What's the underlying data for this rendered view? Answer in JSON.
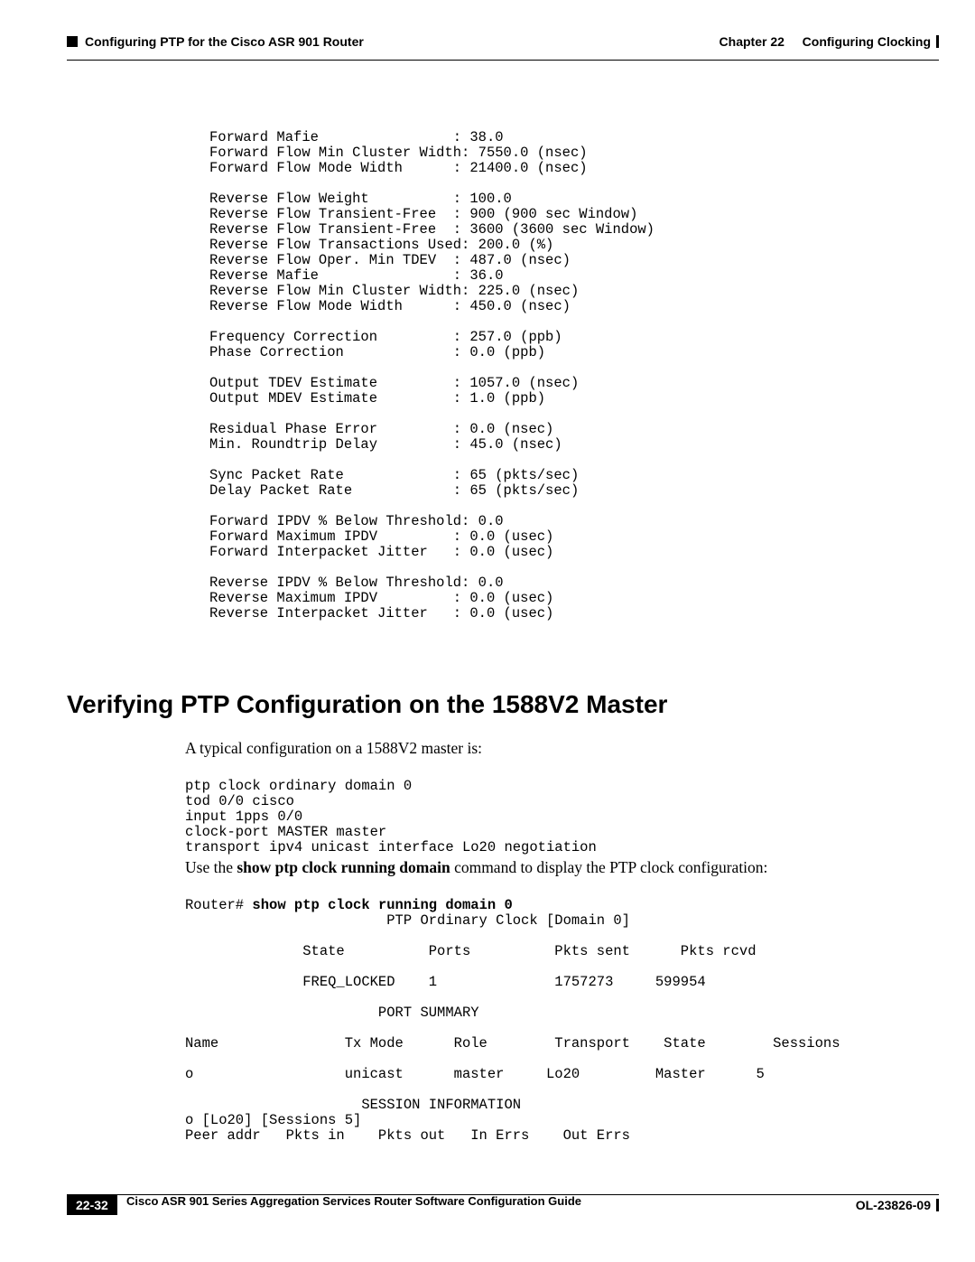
{
  "header": {
    "chapter": "Chapter 22",
    "chapter_title": "Configuring Clocking",
    "section": "Configuring PTP for the Cisco ASR 901 Router"
  },
  "code1_lines": [
    "Forward Mafie                : 38.0",
    "Forward Flow Min Cluster Width: 7550.0 (nsec)",
    "Forward Flow Mode Width      : 21400.0 (nsec)",
    "",
    "Reverse Flow Weight          : 100.0",
    "Reverse Flow Transient-Free  : 900 (900 sec Window)",
    "Reverse Flow Transient-Free  : 3600 (3600 sec Window)",
    "Reverse Flow Transactions Used: 200.0 (%)",
    "Reverse Flow Oper. Min TDEV  : 487.0 (nsec)",
    "Reverse Mafie                : 36.0",
    "Reverse Flow Min Cluster Width: 225.0 (nsec)",
    "Reverse Flow Mode Width      : 450.0 (nsec)",
    "",
    "Frequency Correction         : 257.0 (ppb)",
    "Phase Correction             : 0.0 (ppb)",
    "",
    "Output TDEV Estimate         : 1057.0 (nsec)",
    "Output MDEV Estimate         : 1.0 (ppb)",
    "",
    "Residual Phase Error         : 0.0 (nsec)",
    "Min. Roundtrip Delay         : 45.0 (nsec)",
    "",
    "Sync Packet Rate             : 65 (pkts/sec)",
    "Delay Packet Rate            : 65 (pkts/sec)",
    "",
    "Forward IPDV % Below Threshold: 0.0",
    "Forward Maximum IPDV         : 0.0 (usec)",
    "Forward Interpacket Jitter   : 0.0 (usec)",
    "",
    "Reverse IPDV % Below Threshold: 0.0",
    "Reverse Maximum IPDV         : 0.0 (usec)",
    "Reverse Interpacket Jitter   : 0.0 (usec)"
  ],
  "section_heading": "Verifying PTP Configuration on the 1588V2 Master",
  "intro_text": "A typical configuration on a 1588V2 master is:",
  "code2_lines": [
    "ptp clock ordinary domain 0",
    "tod 0/0 cisco",
    "input 1pps 0/0",
    "clock-port MASTER master",
    "transport ipv4 unicast interface Lo20 negotiation"
  ],
  "use_text": {
    "prefix": "Use the ",
    "bold": "show ptp clock running domain",
    "suffix": " command to display the PTP clock configuration:"
  },
  "code3_prefix": "Router# ",
  "code3_bold": "show ptp clock running domain 0",
  "code3_rest": [
    "                        PTP Ordinary Clock [Domain 0]",
    "",
    "              State          Ports          Pkts sent      Pkts rcvd",
    "",
    "              FREQ_LOCKED    1              1757273     599954",
    "",
    "                       PORT SUMMARY",
    "",
    "Name               Tx Mode      Role        Transport    State        Sessions",
    "",
    "o                  unicast      master     Lo20         Master      5",
    "",
    "                     SESSION INFORMATION",
    "o [Lo20] [Sessions 5]",
    "Peer addr   Pkts in    Pkts out   In Errs    Out Errs"
  ],
  "footer": {
    "guide_title": "Cisco ASR 901 Series Aggregation Services Router Software Configuration Guide",
    "page_number": "22-32",
    "doc_id": "OL-23826-09"
  }
}
